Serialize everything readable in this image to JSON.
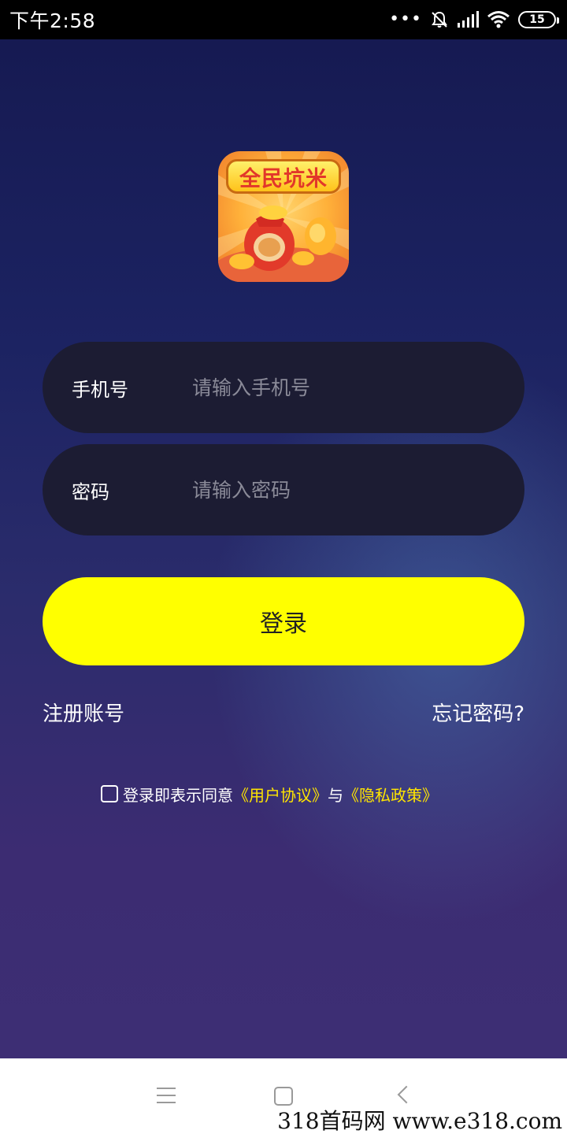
{
  "status_bar": {
    "time": "下午2:58",
    "dots": "•••",
    "battery": "15"
  },
  "app": {
    "logo_text": "全民坑米"
  },
  "form": {
    "phone": {
      "label": "手机号",
      "placeholder": "请输入手机号"
    },
    "password": {
      "label": "密码",
      "placeholder": "请输入密码"
    },
    "login_button": "登录",
    "register_link": "注册账号",
    "forgot_link": "忘记密码?",
    "agreement": {
      "prefix": "登录即表示同意",
      "user_agreement": "《用户协议》",
      "conjunction": "与",
      "privacy_policy": "《隐私政策》"
    }
  },
  "watermark": "318首码网 www.e318.com",
  "colors": {
    "accent": "#ffff00",
    "link_yellow": "#ffe500",
    "field_bg": "#1c1c33"
  }
}
